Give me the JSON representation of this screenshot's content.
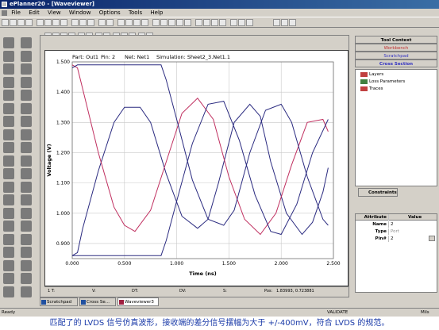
{
  "window": {
    "title": "ePlanner20 - [Waveviewer]"
  },
  "menu": [
    "File",
    "Edit",
    "View",
    "Window",
    "Options",
    "Tools",
    "Help"
  ],
  "plot_header": {
    "part": "Part: Out1",
    "pin": "Pin: 2",
    "net": "Net: Net1",
    "simulation": "Simulation: Sheet2_3.Net1.1"
  },
  "chart_data": {
    "type": "line",
    "xlabel": "Time (ns)",
    "ylabel": "Voltage (V)",
    "xlim": [
      0,
      2.5
    ],
    "ylim": [
      0.85,
      1.5
    ],
    "x_ticks": [
      "0.000",
      "0.500",
      "1.000",
      "1.500",
      "2.000",
      "2.500"
    ],
    "y_ticks": [
      "1.500",
      "1.400",
      "1.300",
      "1.200",
      "1.100",
      "1.000",
      "0.900"
    ],
    "grid": true,
    "series": [
      {
        "color": "#2b2b80",
        "x": [
          0,
          0.05,
          0.1,
          0.25,
          0.4,
          0.5,
          0.65,
          0.75,
          0.9,
          1.05,
          1.2,
          1.3,
          1.4,
          1.55,
          1.7,
          1.8,
          1.9,
          2.05,
          2.2,
          2.3,
          2.4,
          2.45
        ],
        "y": [
          0.86,
          0.87,
          0.95,
          1.14,
          1.3,
          1.35,
          1.35,
          1.3,
          1.13,
          0.99,
          0.95,
          0.98,
          1.1,
          1.3,
          1.36,
          1.32,
          1.17,
          1.0,
          0.93,
          0.97,
          1.07,
          1.15
        ]
      },
      {
        "color": "#c03060",
        "x": [
          0,
          0.05,
          0.1,
          0.25,
          0.4,
          0.5,
          0.6,
          0.75,
          0.9,
          1.05,
          1.2,
          1.35,
          1.5,
          1.65,
          1.8,
          1.95,
          2.1,
          2.25,
          2.4,
          2.45
        ],
        "y": [
          1.49,
          1.48,
          1.41,
          1.2,
          1.02,
          0.96,
          0.94,
          1.01,
          1.17,
          1.33,
          1.38,
          1.31,
          1.12,
          0.98,
          0.93,
          1.0,
          1.16,
          1.3,
          1.31,
          1.27
        ]
      },
      {
        "color": "#2b2b80",
        "x": [
          0,
          0.05,
          0.3,
          0.6,
          0.85,
          0.9,
          1.0,
          1.15,
          1.3,
          1.45,
          1.55,
          1.7,
          1.85,
          2.0,
          2.1,
          2.25,
          2.4,
          2.45
        ],
        "y": [
          1.48,
          1.49,
          1.49,
          1.49,
          1.49,
          1.44,
          1.31,
          1.11,
          0.98,
          0.96,
          1.01,
          1.2,
          1.34,
          1.36,
          1.3,
          1.12,
          0.98,
          0.96
        ]
      },
      {
        "color": "#2b2b80",
        "x": [
          0,
          0.05,
          0.3,
          0.6,
          0.85,
          0.9,
          1.0,
          1.15,
          1.3,
          1.45,
          1.6,
          1.75,
          1.9,
          2.0,
          2.15,
          2.3,
          2.45
        ],
        "y": [
          0.86,
          0.86,
          0.86,
          0.86,
          0.86,
          0.91,
          1.04,
          1.23,
          1.36,
          1.37,
          1.24,
          1.06,
          0.94,
          0.93,
          1.03,
          1.2,
          1.31
        ]
      }
    ]
  },
  "status_row": {
    "t1": "1 T:",
    "v": "V:",
    "dt": "DT:",
    "dv": "DV:",
    "s": "S:",
    "pos_label": "Pos:",
    "pos_value": "1.83993, 0.723881"
  },
  "tabs": [
    "Scratchpad",
    "Cross Se...",
    "Waveviewer3"
  ],
  "right_panel": {
    "tool_context": "Tool Context",
    "workbench": "Workbench",
    "scratchpad": "Scratchpad",
    "cross_section": "Cross Section",
    "tree": [
      "Layers",
      "Loss Parameters",
      "Traces"
    ],
    "constraints": "Constraints",
    "attr_header": [
      "Attribute",
      "Value"
    ],
    "attrs": [
      {
        "k": "Name",
        "v": "2"
      },
      {
        "k": "Type",
        "v": "Port"
      },
      {
        "k": "Pin#",
        "v": "2"
      }
    ]
  },
  "statusbar": {
    "left": "Ready",
    "validate": "VALIDATE",
    "mils": "Mils"
  },
  "caption": "匹配了的 LVDS 信号仿真波形，接收端的差分信号摆幅为大于 +/-400mV，符合 LVDS 的规范。",
  "colors": {
    "title_bar": "#0a246a",
    "caption": "#1a3aa8",
    "series_blue": "#2b2b80",
    "series_red": "#c03060"
  }
}
